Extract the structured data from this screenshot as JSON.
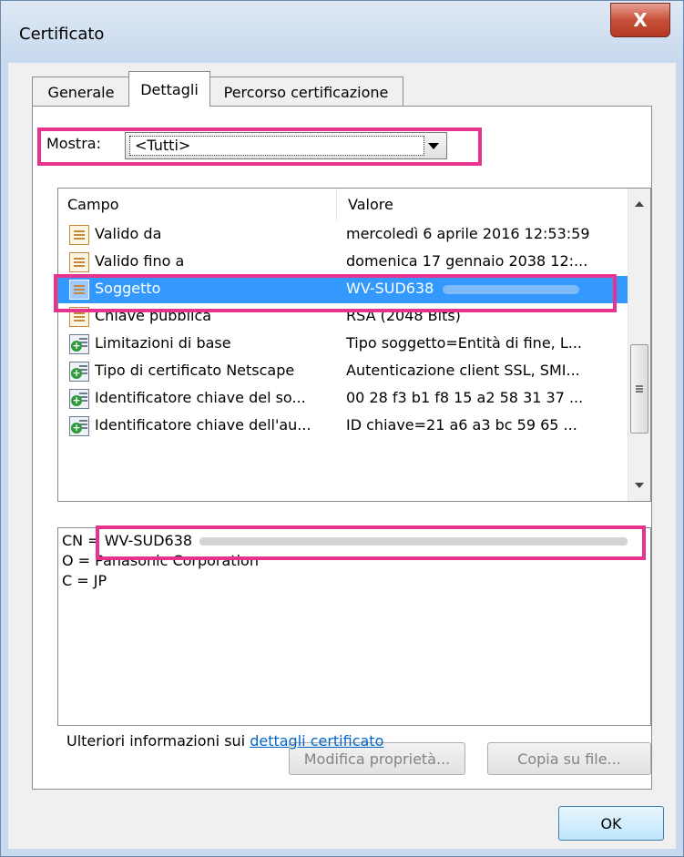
{
  "window": {
    "title": "Certificato",
    "close_label": "X"
  },
  "tabs": [
    {
      "label": "Generale"
    },
    {
      "label": "Dettagli"
    },
    {
      "label": "Percorso certificazione"
    }
  ],
  "show": {
    "label": "Mostra:",
    "value": "<Tutti>"
  },
  "list": {
    "columns": [
      "Campo",
      "Valore"
    ],
    "rows": [
      {
        "field": "Valido da",
        "value": "mercoledì 6 aprile 2016 12:53:59"
      },
      {
        "field": "Valido fino a",
        "value": "domenica 17 gennaio 2038 12:..."
      },
      {
        "field": "Soggetto",
        "value": "WV-SUD638"
      },
      {
        "field": "Chiave pubblica",
        "value": "RSA (2048 Bits)"
      },
      {
        "field": "Limitazioni di base",
        "value": "Tipo soggetto=Entità di fine, L..."
      },
      {
        "field": "Tipo di certificato Netscape",
        "value": "Autenticazione client SSL, SMI..."
      },
      {
        "field": "Identificatore chiave del so...",
        "value": "00 28 f3 b1 f8 15 a2 58 31 37 ..."
      },
      {
        "field": "Identificatore chiave dell'au...",
        "value": "ID chiave=21 a6 a3 bc 59 65 ..."
      }
    ],
    "selected_index": 2
  },
  "detail": {
    "lines": [
      "CN = WV-SUD638",
      "O = Panasonic Corporation",
      "C = JP"
    ]
  },
  "buttons": {
    "edit_properties": "Modifica proprietà...",
    "copy_to_file": "Copia su file...",
    "ok": "OK"
  },
  "info": {
    "text": "Ulteriori informazioni sui ",
    "link": "dettagli certificato"
  },
  "colors": {
    "highlight": "#e7338e",
    "selection": "#3399ff",
    "link": "#0066cc"
  }
}
